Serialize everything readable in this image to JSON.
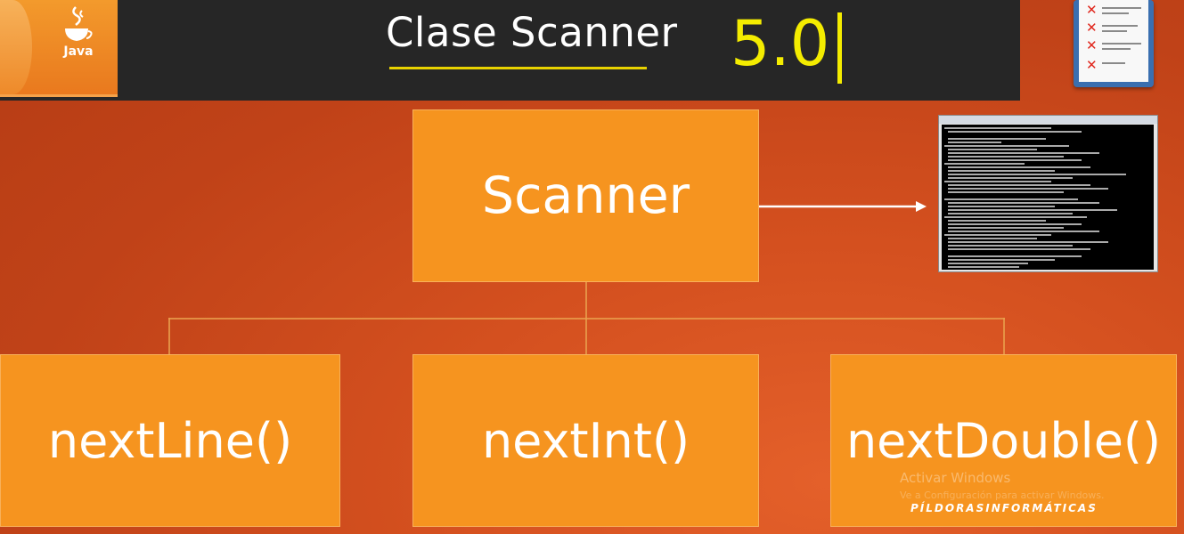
{
  "header": {
    "logo_text": "Java",
    "title": "Clase Scanner",
    "version": "5.0"
  },
  "diagram": {
    "root": "Scanner",
    "children": [
      "nextLine()",
      "nextInt()",
      "nextDouble()"
    ]
  },
  "colors": {
    "box": "#f6941f",
    "title_underline": "#e8d200",
    "version": "#f4ec00",
    "header_bg": "#262626"
  },
  "overlay": {
    "watermark_title": "Activar Windows",
    "watermark_sub": "Ve a Configuración para activar Windows.",
    "brand": "PÍLDORASINFORMÁTICAS"
  },
  "icons": [
    "java-logo-icon",
    "checklist-clipboard-icon",
    "command-console-thumbnail",
    "arrow-right-icon"
  ]
}
